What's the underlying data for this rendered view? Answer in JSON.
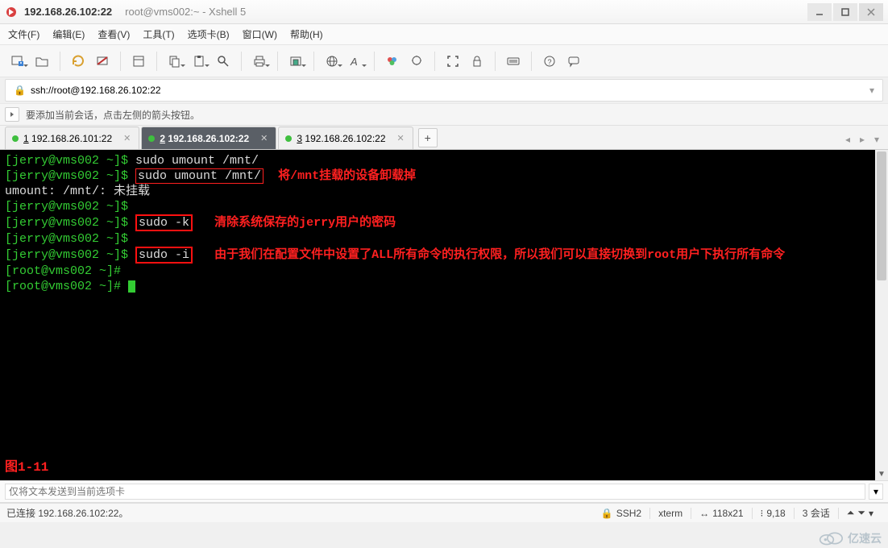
{
  "title": {
    "primary": "192.168.26.102:22",
    "secondary": "root@vms002:~ - Xshell 5"
  },
  "menus": {
    "file": "文件(F)",
    "edit": "编辑(E)",
    "view": "查看(V)",
    "tools": "工具(T)",
    "tabs": "选项卡(B)",
    "window": "窗口(W)",
    "help": "帮助(H)"
  },
  "address": {
    "url": "ssh://root@192.168.26.102:22"
  },
  "hint": {
    "text": "要添加当前会话，点击左侧的箭头按钮。"
  },
  "tabs": [
    {
      "num": "1",
      "label": "192.168.26.101:22"
    },
    {
      "num": "2",
      "label": "192.168.26.102:22"
    },
    {
      "num": "3",
      "label": "192.168.26.102:22"
    }
  ],
  "terminal": {
    "lines": [
      {
        "prompt": "[jerry@vms002 ~]$ ",
        "cmd": "sudo umount /mnt/"
      },
      {
        "prompt": "[jerry@vms002 ~]$ ",
        "box": "sudo umount /mnt/",
        "note": "将/mnt挂载的设备卸载掉"
      },
      {
        "plain": "umount: /mnt/: 未挂载"
      },
      {
        "prompt": "[jerry@vms002 ~]$ "
      },
      {
        "prompt": "[jerry@vms002 ~]$ ",
        "bigbox": "sudo -k",
        "note": "清除系统保存的jerry用户的密码",
        "pad": "   "
      },
      {
        "prompt": "[jerry@vms002 ~]$ "
      },
      {
        "prompt": "[jerry@vms002 ~]$ ",
        "bigbox": "sudo -i",
        "note": "由于我们在配置文件中设置了ALL所有命令的执行权限，所以我们可以直接切换到root用户下执行所有命令",
        "pad": "   "
      },
      {
        "rootprompt": "[root@vms002 ~]# "
      },
      {
        "rootprompt": "[root@vms002 ~]# ",
        "cursor": true
      }
    ],
    "figure": "图1-11"
  },
  "sendbar": {
    "placeholder": "仅将文本发送到当前选项卡"
  },
  "status": {
    "connected": "已连接 192.168.26.102:22。",
    "proto": "SSH2",
    "term": "xterm",
    "size": "118x21",
    "cursor": "9,18",
    "sessions_label": "3 会话",
    "arrows": "⇅",
    "lock": "🔒",
    "updown": "↕",
    "plusminus": "⁝"
  },
  "watermark": {
    "text": "亿速云"
  }
}
